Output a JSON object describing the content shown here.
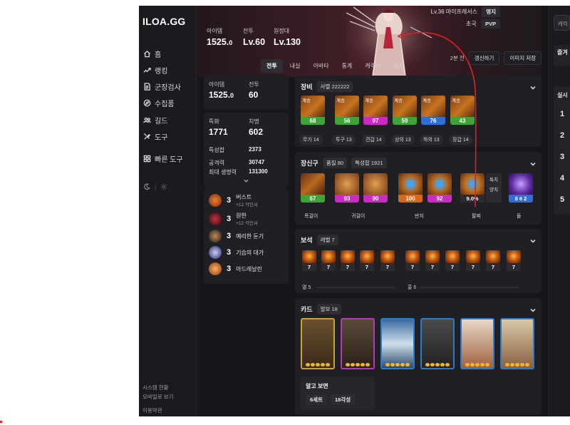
{
  "sidebar": {
    "logo": "ILOA.GG",
    "items": [
      {
        "label": "홈",
        "icon": "home-icon"
      },
      {
        "label": "랭킹",
        "icon": "trend-icon"
      },
      {
        "label": "군장검사",
        "icon": "document-icon"
      },
      {
        "label": "수집품",
        "icon": "compass-icon"
      },
      {
        "label": "길드",
        "icon": "users-icon"
      },
      {
        "label": "도구",
        "icon": "tools-icon"
      },
      {
        "label": "빠른 도구",
        "icon": "grid-icon"
      }
    ],
    "footer": [
      "시스템 현황",
      "모바일로 보기",
      "이용약관"
    ]
  },
  "hero": {
    "stats": [
      {
        "label": "아이템",
        "value": "1525.",
        "value_small": "0"
      },
      {
        "label": "전투",
        "value": "Lv.60"
      },
      {
        "label": "원정대",
        "value": "Lv.130"
      }
    ],
    "level_line": "Lv.36 마이프레서스",
    "badge_guild": "영지",
    "title_text": "초국",
    "badge_pvp": "PVP",
    "time_ago": "2분 전",
    "refresh_button": "갱신하기",
    "save_image_button": "이미지 저장"
  },
  "tabs": [
    "전투",
    "내실",
    "아바타",
    "통계",
    "캐릭터",
    "길드"
  ],
  "left_panel": {
    "item_level_label": "아이템",
    "item_level_value": "1525.",
    "item_level_small": "0",
    "combat_label": "전투",
    "combat_value": "60",
    "crit_label": "특화",
    "crit_value": "1771",
    "swift_label": "치명",
    "swift_value": "602",
    "total_stat_label": "특성합",
    "total_stat_value": "2373",
    "attack_label": "공격력",
    "attack_value": "30747",
    "hp_label": "최대 생명력",
    "hp_value": "131300",
    "engravings": [
      {
        "num": "3",
        "name": "버스트",
        "sub": "+12 각인서",
        "color": "#c4541a"
      },
      {
        "num": "3",
        "name": "원한",
        "sub": "+12 각인서",
        "color": "#7a1a22"
      },
      {
        "num": "3",
        "name": "예리한 둔기",
        "sub": "",
        "color": "#2c2c38"
      },
      {
        "num": "3",
        "name": "기습의 대가",
        "sub": "",
        "color": "#3a3c6a"
      },
      {
        "num": "3",
        "name": "아드레날린",
        "sub": "",
        "color": "#a8481a"
      }
    ]
  },
  "equipment": {
    "title": "장비",
    "tag": "사멸 222222",
    "items": [
      {
        "inherit": "계승",
        "quality": "68",
        "qclass": "q-green",
        "caption": "무기 14"
      },
      {
        "inherit": "계승",
        "quality": "56",
        "qclass": "q-green",
        "caption": "투구 13"
      },
      {
        "inherit": "계승",
        "quality": "97",
        "qclass": "q-magenta",
        "caption": "견갑 14"
      },
      {
        "inherit": "계승",
        "quality": "59",
        "qclass": "q-green",
        "caption": "상의 13"
      },
      {
        "inherit": "계승",
        "quality": "76",
        "qclass": "q-blue",
        "caption": "하의 13"
      },
      {
        "inherit": "계승",
        "quality": "43",
        "qclass": "q-green",
        "caption": "장갑 14"
      }
    ]
  },
  "accessories": {
    "title": "장신구",
    "tag1": "품질 80",
    "tag2": "특성합 1921",
    "items": [
      {
        "quality": "67",
        "qclass": "q-green"
      },
      {
        "quality": "93",
        "qclass": "q-magenta"
      },
      {
        "quality": "90",
        "qclass": "q-magenta"
      },
      {
        "quality": "100",
        "qclass": "q-orange"
      },
      {
        "quality": "92",
        "qclass": "q-magenta"
      }
    ],
    "captions": [
      "목걸이",
      "귀걸이",
      "반지"
    ],
    "bracelet": {
      "value": "9.0%",
      "label1": "특치",
      "label2": "양치",
      "caption": "팔찌"
    },
    "stone": {
      "value": "8 6 2",
      "caption": "돌"
    }
  },
  "gems": {
    "title": "보석",
    "tag": "레벨 7",
    "levels": [
      "7",
      "7",
      "7",
      "7",
      "7",
      "7",
      "7",
      "7",
      "7",
      "7",
      "7"
    ],
    "left_caption": "멸 5",
    "right_caption": "홍 6"
  },
  "cards": {
    "title": "카드",
    "tag": "알보 18",
    "set_name": "알고 보면",
    "set_badge1": "6세트",
    "set_badge2": "18각성"
  },
  "right_col": {
    "search_placeholder": "캐릭",
    "fav_label": "즐겨",
    "live_label": "실시",
    "ranks": [
      "1",
      "2",
      "3",
      "4",
      "5"
    ]
  },
  "colors": {
    "annotation_red": "#e02020",
    "accent_bg": "#17171b"
  }
}
